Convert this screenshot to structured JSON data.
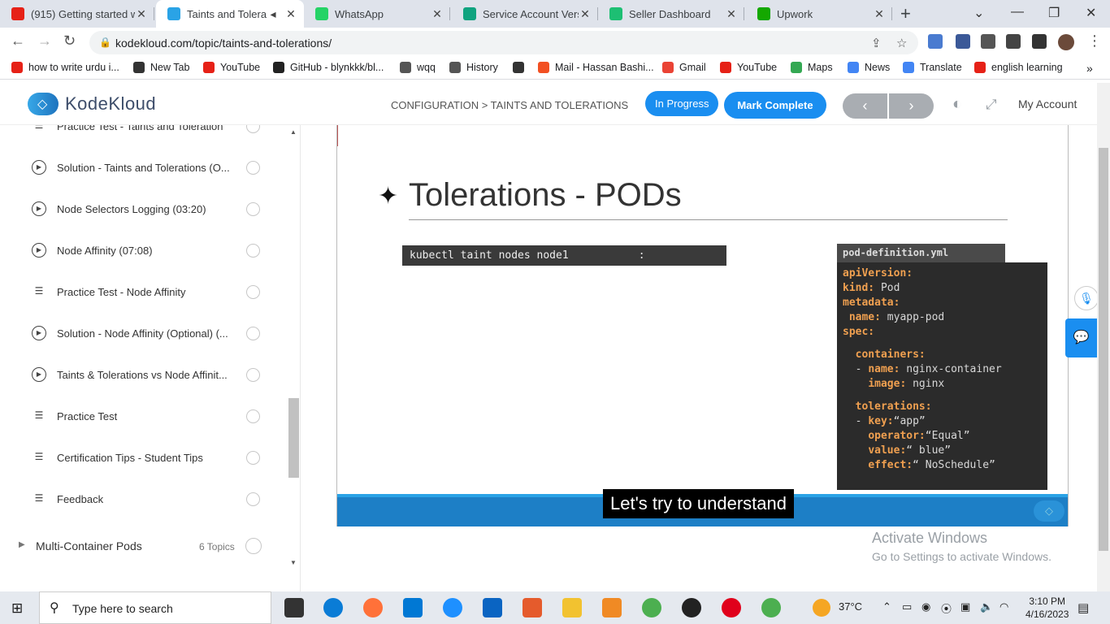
{
  "browser": {
    "tabs": [
      {
        "title": "(915) Getting started w",
        "color": "#e62117",
        "active": false
      },
      {
        "title": "Taints and Tolerati",
        "color": "#2aa3e6",
        "active": true
      },
      {
        "title": "WhatsApp",
        "color": "#25d366",
        "active": false
      },
      {
        "title": "Service Account Versio",
        "color": "#10a37f",
        "active": false
      },
      {
        "title": "Seller Dashboard",
        "color": "#1dbf73",
        "active": false
      },
      {
        "title": "Upwork",
        "color": "#14a800",
        "active": false
      }
    ],
    "url": "kodekloud.com/topic/taints-and-tolerations/",
    "bookmarks": [
      {
        "label": "how to write urdu i...",
        "color": "#e62117"
      },
      {
        "label": "New Tab",
        "color": "#333333"
      },
      {
        "label": "YouTube",
        "color": "#e62117"
      },
      {
        "label": "GitHub - blynkkk/bl...",
        "color": "#222222"
      },
      {
        "label": "wqq",
        "color": "#555555"
      },
      {
        "label": "History",
        "color": "#555555"
      },
      {
        "label": "",
        "color": "#333333"
      },
      {
        "label": "Mail - Hassan Bashi...",
        "color": "#f25022"
      },
      {
        "label": "Gmail",
        "color": "#ea4335"
      },
      {
        "label": "YouTube",
        "color": "#e62117"
      },
      {
        "label": "Maps",
        "color": "#34a853"
      },
      {
        "label": "News",
        "color": "#4285f4"
      },
      {
        "label": "Translate",
        "color": "#4285f4"
      },
      {
        "label": "english learning",
        "color": "#e62117"
      }
    ]
  },
  "header": {
    "logo": "KodeKloud",
    "breadcrumb": "CONFIGURATION > TAINTS AND TOLERATIONS",
    "in_progress": "In Progress",
    "mark_complete": "Mark Complete",
    "prev": "‹",
    "next": "›",
    "account": "My Account"
  },
  "sidebar": {
    "lessons": [
      {
        "icon": "list",
        "label": "Practice Test - Taints and Toleration"
      },
      {
        "icon": "play",
        "label": "Solution - Taints and Tolerations (O..."
      },
      {
        "icon": "play",
        "label": "Node Selectors Logging (03:20)"
      },
      {
        "icon": "play",
        "label": "Node Affinity (07:08)"
      },
      {
        "icon": "list",
        "label": "Practice Test - Node Affinity"
      },
      {
        "icon": "play",
        "label": "Solution - Node Affinity (Optional) (..."
      },
      {
        "icon": "play",
        "label": "Taints & Tolerations vs Node Affinit..."
      },
      {
        "icon": "list",
        "label": "Practice Test"
      },
      {
        "icon": "list",
        "label": "Certification Tips - Student Tips"
      },
      {
        "icon": "list",
        "label": "Feedback"
      }
    ],
    "section": {
      "label": "Multi-Container Pods",
      "count": "6 Topics"
    }
  },
  "slide": {
    "title": "Tolerations - PODs",
    "command": "kubectl taint nodes node1           :",
    "file_tab": "pod-definition.yml",
    "yaml": [
      [
        {
          "k": "apiVersion:"
        }
      ],
      [
        {
          "k": "kind:"
        },
        {
          "v": " Pod"
        }
      ],
      [
        {
          "k": "metadata:"
        }
      ],
      [
        {
          "v": " "
        },
        {
          "k": "name:"
        },
        {
          "v": " myapp-pod"
        }
      ],
      [
        {
          "k": "spec:"
        }
      ],
      "gap",
      [
        {
          "v": "  "
        },
        {
          "k": "containers:"
        }
      ],
      [
        {
          "v": "  - "
        },
        {
          "k": "name:"
        },
        {
          "v": " nginx-container"
        }
      ],
      [
        {
          "v": "    "
        },
        {
          "k": "image:"
        },
        {
          "v": " nginx"
        }
      ],
      "gap",
      [
        {
          "v": "  "
        },
        {
          "k": "tolerations:"
        }
      ],
      [
        {
          "v": "  - "
        },
        {
          "k": "key:"
        },
        {
          "v": "“app”"
        }
      ],
      [
        {
          "v": "    "
        },
        {
          "k": "operator:"
        },
        {
          "v": "“Equal”"
        }
      ],
      [
        {
          "v": "    "
        },
        {
          "k": "value:"
        },
        {
          "v": "“ blue”"
        }
      ],
      [
        {
          "v": "    "
        },
        {
          "k": "effect:"
        },
        {
          "v": "“ NoSchedule”"
        }
      ]
    ],
    "caption": "Let's try to understand"
  },
  "watermark": {
    "line1": "Activate Windows",
    "line2": "Go to Settings to activate Windows."
  },
  "taskbar": {
    "search_placeholder": "Type here to search",
    "weather": "37°C",
    "time": "3:10 PM",
    "date": "4/16/2023"
  }
}
